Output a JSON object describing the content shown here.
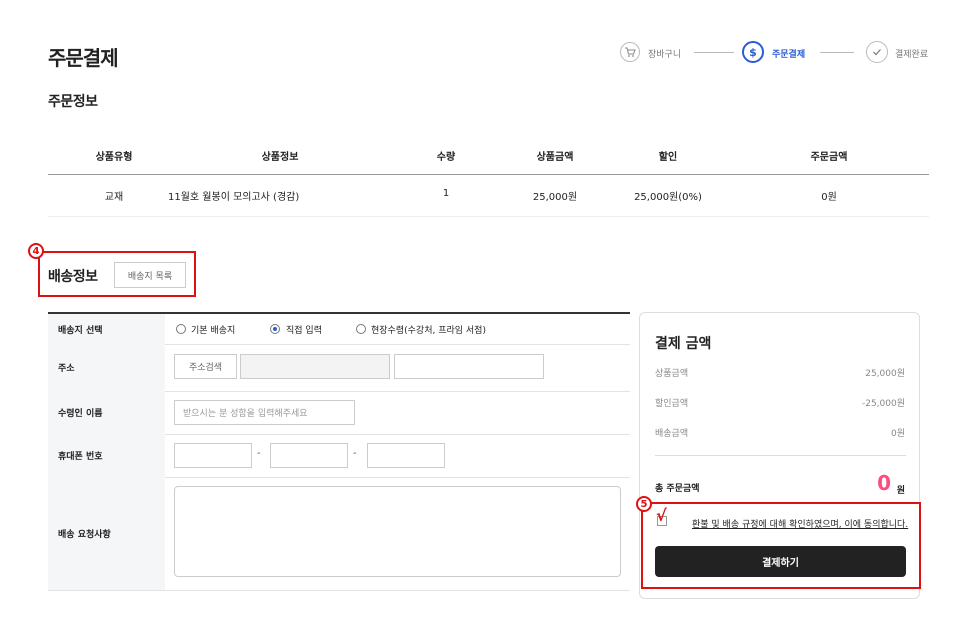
{
  "page": {
    "title": "주문결제"
  },
  "steps": [
    {
      "icon": "cart-icon",
      "label": "장바구니"
    },
    {
      "icon": "dollar-icon",
      "label": "주문결제"
    },
    {
      "icon": "check-icon",
      "label": "결제완료"
    }
  ],
  "order_info": {
    "title": "주문정보",
    "headers": [
      "상품유형",
      "상품정보",
      "수량",
      "상품금액",
      "할인",
      "주문금액"
    ],
    "rows": [
      [
        "교재",
        "11월호 월봉이 모의고사 (경감)",
        "1",
        "25,000원",
        "25,000원(0%)",
        "0원"
      ]
    ]
  },
  "shipping": {
    "badge": "4",
    "title": "배송정보",
    "list_button": "배송지 목록",
    "labels": {
      "select": "배송지 선택",
      "address": "주소",
      "recipient": "수령인 이름",
      "phone": "휴대폰 번호",
      "request": "배송 요청사항"
    },
    "options": [
      "기본 배송지",
      "직접 입력",
      "현장수령(수강처, 프라임 서점)"
    ],
    "selected_option": "직접 입력",
    "address_search_button": "주소검색",
    "recipient_placeholder": "받으시는 분 성함을 입력해주세요",
    "phone_separator": "-"
  },
  "payment": {
    "title": "결제 금액",
    "lines": [
      {
        "label": "상품금액",
        "value": "25,000원"
      },
      {
        "label": "할인금액",
        "value": "-25,000원"
      },
      {
        "label": "배송금액",
        "value": "0원"
      }
    ],
    "total_label": "총 주문금액",
    "total_value": "0",
    "total_unit": "원",
    "badge": "5",
    "check_mark": "√",
    "agree_text": "환불 및 배송 규정에 대해 확인하였으며, 이에 동의합니다.",
    "pay_button": "결제하기",
    "accent_color": "#ff4c7e"
  },
  "annotation_color": "#dd1111"
}
